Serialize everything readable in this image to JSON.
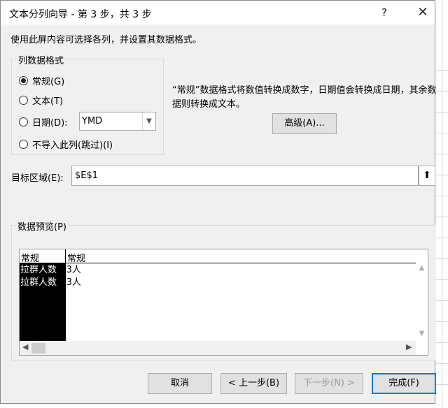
{
  "dialog": {
    "title": "文本分列向导 - 第 3 步，共 3 步",
    "help_glyph": "?",
    "close_glyph": "✕"
  },
  "instruction": "使用此屏内容可选择各列，并设置其数据格式。",
  "column_format": {
    "legend": "列数据格式",
    "options": [
      {
        "label": "常规(G)",
        "selected": true
      },
      {
        "label": "文本(T)",
        "selected": false
      },
      {
        "label": "日期(D):",
        "selected": false
      },
      {
        "label": "不导入此列(跳过)(I)",
        "selected": false
      }
    ],
    "date_format": "YMD"
  },
  "description": "“常规”数据格式将数值转换成数字，日期值会转换成日期，其余数据则转换成文本。",
  "advanced_button": "高级(A)...",
  "destination": {
    "label": "目标区域(E):",
    "value": "$E$1",
    "collapse_icon": "collapse-dialog-icon"
  },
  "preview": {
    "legend": "数据预览(P)",
    "headers": [
      "常规",
      "常规"
    ],
    "rows": [
      [
        "拉群人数",
        "3人"
      ],
      [
        "拉群人数",
        "3人"
      ]
    ]
  },
  "buttons": {
    "cancel": "取消",
    "back": "< 上一步(B)",
    "next": "下一步(N) >",
    "finish": "完成(F)"
  }
}
